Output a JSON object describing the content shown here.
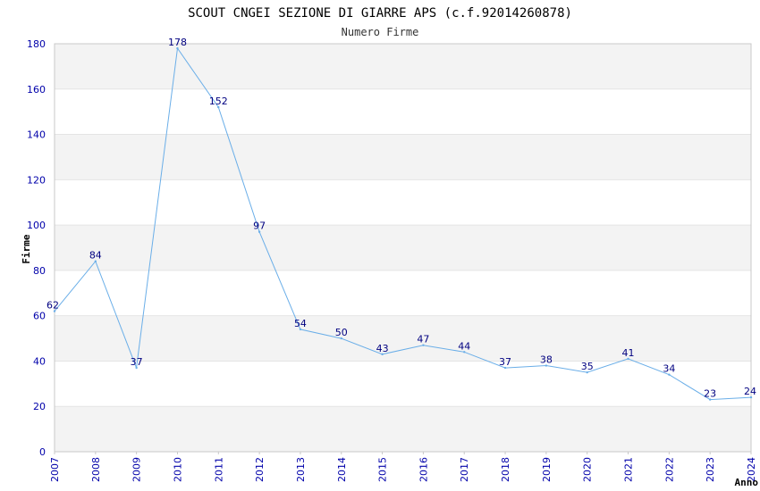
{
  "chart_data": {
    "type": "line",
    "title": "SCOUT CNGEI SEZIONE DI GIARRE APS (c.f.92014260878)",
    "subtitle": "Numero Firme",
    "xlabel": "Anno",
    "ylabel": "Firme",
    "ylim": [
      0,
      180
    ],
    "y_ticks": [
      "0",
      "20",
      "40",
      "60",
      "80",
      "100",
      "120",
      "140",
      "160",
      "180"
    ],
    "categories": [
      "2007",
      "2008",
      "2009",
      "2010",
      "2011",
      "2012",
      "2013",
      "2014",
      "2015",
      "2016",
      "2017",
      "2018",
      "2019",
      "2020",
      "2021",
      "2022",
      "2023",
      "2024"
    ],
    "series": [
      {
        "values": [
          62,
          84,
          37,
          178,
          152,
          97,
          54,
          50,
          43,
          47,
          44,
          37,
          38,
          35,
          41,
          34,
          23,
          24
        ]
      }
    ],
    "grid": true,
    "legend": "none",
    "colors": {
      "line": "#6aaee8",
      "data_label": "#000080",
      "tick_label": "#0000aa",
      "band": "#f3f3f3",
      "gridline": "#e4e4e4",
      "frame": "#c8c8c8",
      "title": "#000000",
      "subtitle": "#333333"
    }
  }
}
